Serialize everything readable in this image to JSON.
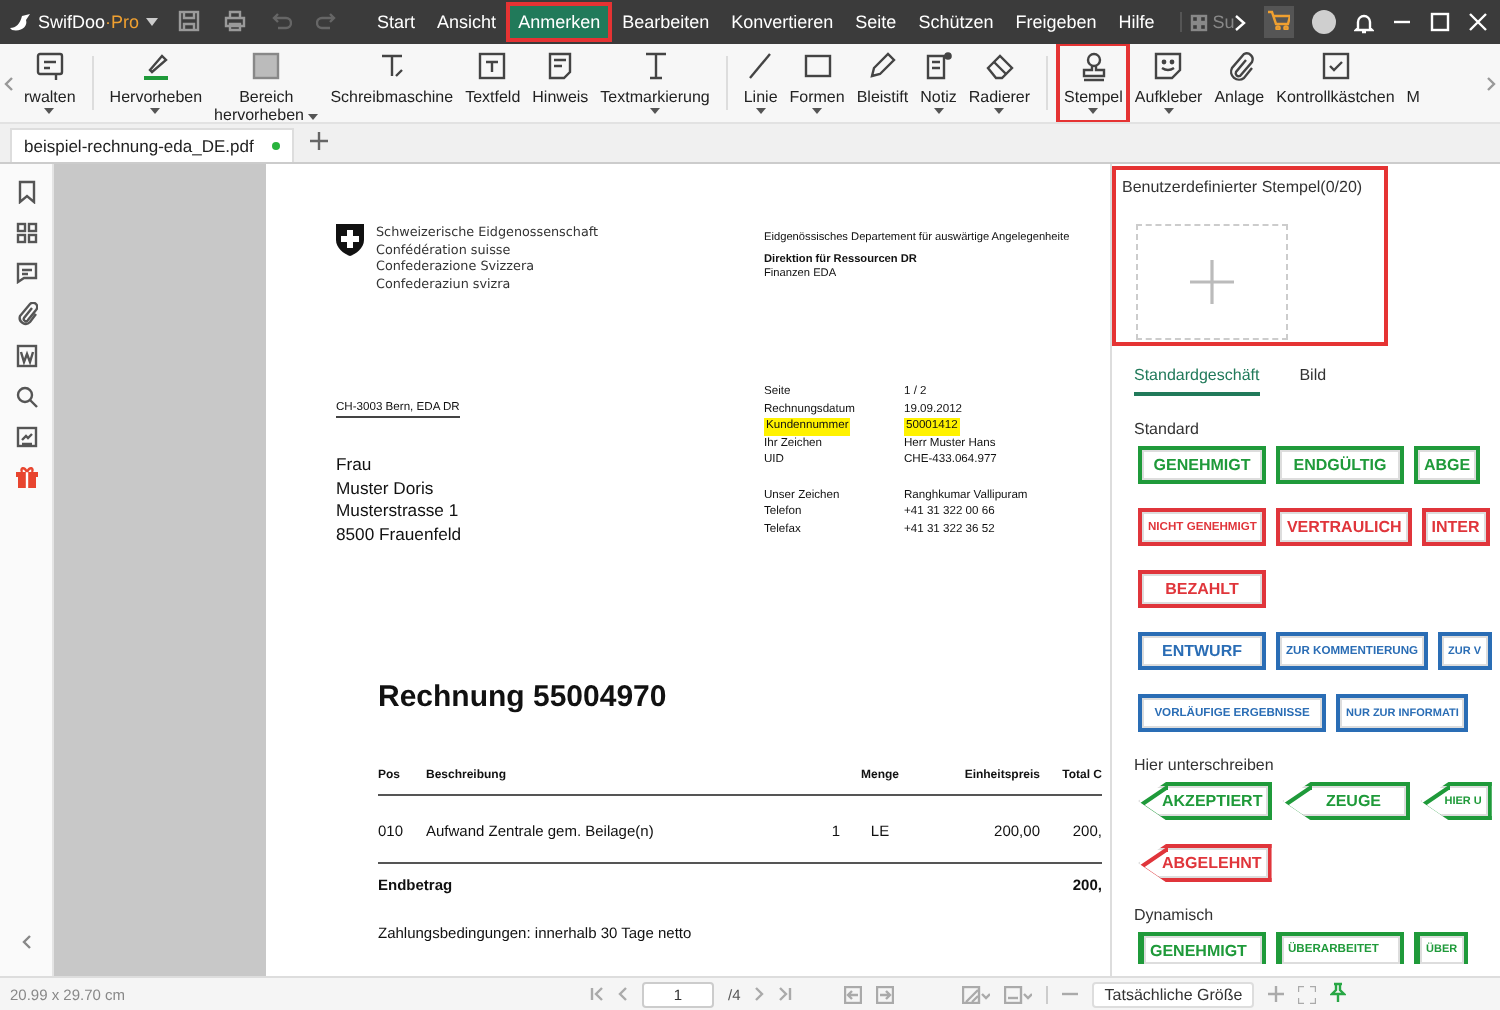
{
  "titlebar": {
    "brand": "SwifDoo",
    "edition": "·Pro",
    "search": {
      "placeholder": "Su"
    },
    "menu": [
      {
        "label": "Start",
        "selected": false,
        "annotated": false
      },
      {
        "label": "Ansicht",
        "selected": false,
        "annotated": false
      },
      {
        "label": "Anmerken",
        "selected": true,
        "annotated": true
      },
      {
        "label": "Bearbeiten",
        "selected": false,
        "annotated": false
      },
      {
        "label": "Konvertieren",
        "selected": false,
        "annotated": false
      },
      {
        "label": "Seite",
        "selected": false,
        "annotated": false
      },
      {
        "label": "Schützen",
        "selected": false,
        "annotated": false
      },
      {
        "label": "Freigeben",
        "selected": false,
        "annotated": false
      },
      {
        "label": "Hilfe",
        "selected": false,
        "annotated": false
      }
    ]
  },
  "toolbar": {
    "groups": [
      [
        {
          "label": "rwalten",
          "kind": "list",
          "has_menu": true,
          "annotated": false
        }
      ],
      [
        {
          "label": "Hervorheben",
          "kind": "highlighter",
          "has_menu": true,
          "annotated": false
        },
        {
          "label": "Bereich hervorheben",
          "kind": "area",
          "has_menu": true,
          "annotated": false
        },
        {
          "label": "Schreibmaschine",
          "kind": "typewriter",
          "has_menu": false,
          "annotated": false
        },
        {
          "label": "Textfeld",
          "kind": "textbox",
          "has_menu": false,
          "annotated": false
        },
        {
          "label": "Hinweis",
          "kind": "note",
          "has_menu": false,
          "annotated": false
        },
        {
          "label": "Textmarkierung",
          "kind": "textmark",
          "has_menu": true,
          "annotated": false
        }
      ],
      [
        {
          "label": "Linie",
          "kind": "line",
          "has_menu": true,
          "annotated": false
        },
        {
          "label": "Formen",
          "kind": "shape",
          "has_menu": true,
          "annotated": false
        },
        {
          "label": "Bleistift",
          "kind": "pencil",
          "has_menu": false,
          "annotated": false
        },
        {
          "label": "Notiz",
          "kind": "memo",
          "has_menu": true,
          "annotated": false
        },
        {
          "label": "Radierer",
          "kind": "eraser",
          "has_menu": true,
          "annotated": false
        }
      ],
      [
        {
          "label": "Stempel",
          "kind": "stamp",
          "has_menu": true,
          "annotated": true
        },
        {
          "label": "Aufkleber",
          "kind": "sticker",
          "has_menu": true,
          "annotated": false
        },
        {
          "label": "Anlage",
          "kind": "clip",
          "has_menu": false,
          "annotated": false
        },
        {
          "label": "Kontrollkästchen",
          "kind": "checkbox",
          "has_menu": false,
          "annotated": false
        },
        {
          "label": "M",
          "kind": "none",
          "has_menu": false,
          "annotated": false
        }
      ]
    ]
  },
  "tab": {
    "title": "beispiel-rechnung-eda_DE.pdf",
    "unsaved": true
  },
  "page": {
    "org_lines": [
      "Schweizerische Eidgenossenschaft",
      "Confédération suisse",
      "Confederazione Svizzera",
      "Confederaziun svizra"
    ],
    "department": "Eidgenössisches Departement für auswärtige Angelegenheite",
    "division": "Direktion für Ressourcen DR",
    "unit": "Finanzen EDA",
    "sender_line": "CH-3003 Bern, EDA DR",
    "recipient": [
      "Frau",
      "Muster Doris",
      "Musterstrasse 1",
      "8500 Frauenfeld"
    ],
    "details": [
      [
        {
          "label": "Seite",
          "value": "1 / 2",
          "highlighted": false
        },
        {
          "label": "Rechnungsdatum",
          "value": "19.09.2012",
          "highlighted": false
        },
        {
          "label": "Kundennummer",
          "value": "50001412",
          "highlighted": true
        },
        {
          "label": "Ihr Zeichen",
          "value": "Herr Muster Hans",
          "highlighted": false
        },
        {
          "label": "UID",
          "value": "CHE-433.064.977",
          "highlighted": false
        }
      ],
      [
        {
          "label": "Unser Zeichen",
          "value": "Ranghkumar Vallipuram",
          "highlighted": false
        },
        {
          "label": "Telefon",
          "value": "+41 31 322 00 66",
          "highlighted": false
        },
        {
          "label": "Telefax",
          "value": "+41 31 322 36 52",
          "highlighted": false
        }
      ]
    ],
    "title": "Rechnung 55004970",
    "table": {
      "columns": [
        "Pos",
        "Beschreibung",
        "",
        "Menge",
        "Einheitspreis",
        "Total C"
      ],
      "rows": [
        [
          "010",
          "Aufwand Zentrale gem. Beilage(n)",
          "1",
          "LE",
          "200,00",
          "200,"
        ]
      ]
    },
    "total": {
      "label": "Endbetrag",
      "value": "200,"
    },
    "terms": "Zahlungsbedingungen: innerhalb 30 Tage netto"
  },
  "stamp_panel": {
    "custom": {
      "title": "Benutzerdefinierter Stempel(0/20)",
      "annotated": true
    },
    "tabs": [
      {
        "label": "Standardgeschäft",
        "selected": true
      },
      {
        "label": "Bild",
        "selected": false
      }
    ],
    "sections": [
      {
        "title": "Standard",
        "rows": [
          [
            {
              "text": "GENEHMIGT",
              "kind": "box",
              "color": "#1f9a3a"
            },
            {
              "text": "ENDGÜLTIG",
              "kind": "box",
              "color": "#1f9a3a"
            },
            {
              "text": "ABGE",
              "kind": "box",
              "color": "#1f9a3a"
            }
          ],
          [
            {
              "text": "NICHT GENEHMIGT",
              "kind": "box",
              "color": "#e0353b"
            },
            {
              "text": "VERTRAULICH",
              "kind": "box",
              "color": "#e0353b"
            },
            {
              "text": "INTER",
              "kind": "box",
              "color": "#e0353b"
            }
          ],
          [
            {
              "text": "BEZAHLT",
              "kind": "box",
              "color": "#e0353b"
            }
          ],
          [
            {
              "text": "ENTWURF",
              "kind": "box",
              "color": "#2a6db5"
            },
            {
              "text": "ZUR KOMMENTIERUNG",
              "kind": "box",
              "color": "#2a6db5"
            },
            {
              "text": "ZUR V",
              "kind": "box",
              "color": "#2a6db5"
            }
          ],
          [
            {
              "text": "VORLÄUFIGE ERGEBNISSE",
              "kind": "box",
              "color": "#2a6db5"
            },
            {
              "text": "NUR ZUR INFORMATI",
              "kind": "box",
              "color": "#2a6db5"
            }
          ]
        ]
      },
      {
        "title": "Hier unterschreiben",
        "rows": [
          [
            {
              "text": "AKZEPTIERT",
              "kind": "arrow",
              "color": "#1f9a3a"
            },
            {
              "text": "ZEUGE",
              "kind": "arrow",
              "color": "#1f9a3a"
            },
            {
              "text": "HIER U",
              "kind": "arrow",
              "color": "#1f9a3a"
            }
          ],
          [
            {
              "text": "ABGELEHNT",
              "kind": "arrow",
              "color": "#e0353b"
            }
          ]
        ]
      },
      {
        "title": "Dynamisch",
        "rows": [
          [
            {
              "text": "GENEHMIGT",
              "kind": "dynamic",
              "color": "#1f9a3a"
            },
            {
              "text": "ÜBERARBEITET",
              "kind": "dynamic",
              "color": "#1f9a3a"
            },
            {
              "text": "ÜBER",
              "kind": "dynamic",
              "color": "#1f9a3a"
            }
          ]
        ]
      }
    ]
  },
  "status_bar": {
    "size": "20.99 x 29.70 cm",
    "page_value": "1",
    "page_total": "/4",
    "zoom": "Tatsächliche Größe"
  }
}
